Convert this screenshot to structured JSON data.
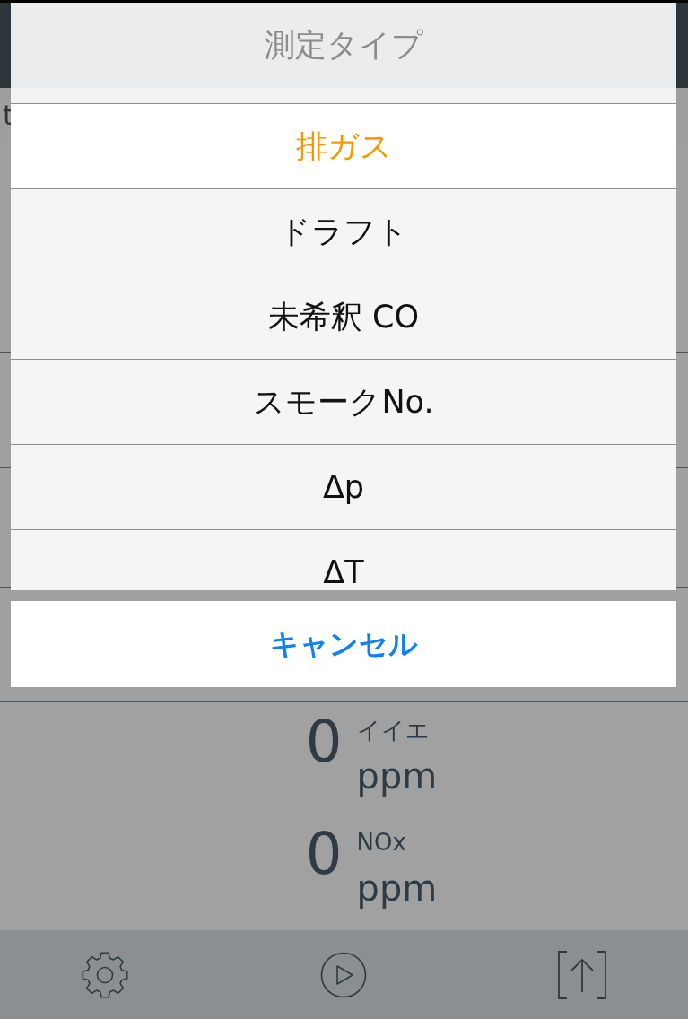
{
  "background": {
    "side_text": "t",
    "readings": [
      {
        "value": "0",
        "label": "イイエ",
        "unit": "ppm"
      },
      {
        "value": "0",
        "label": "NOx",
        "unit": "ppm"
      }
    ]
  },
  "action_sheet": {
    "title": "測定タイプ",
    "options": [
      {
        "label": "排ガス",
        "selected": true
      },
      {
        "label": "ドラフト",
        "selected": false
      },
      {
        "label": "未希釈 CO",
        "selected": false
      },
      {
        "label": "スモークNo.",
        "selected": false
      },
      {
        "label": "Δp",
        "selected": false
      },
      {
        "label": "ΔT",
        "selected": false
      }
    ],
    "cancel_button": "キャンセル"
  }
}
